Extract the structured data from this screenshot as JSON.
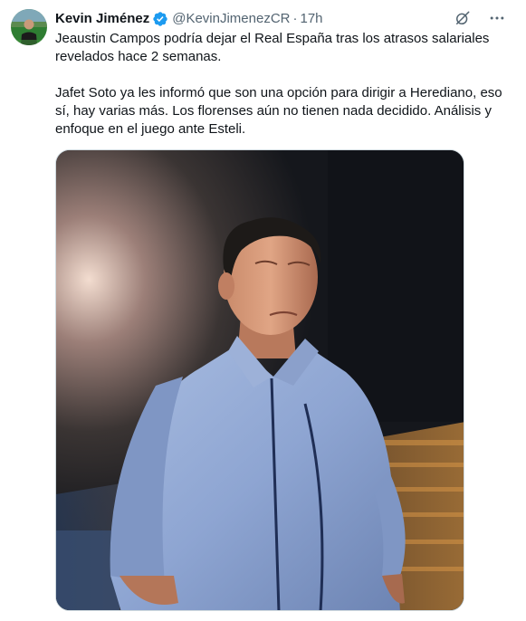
{
  "tweet": {
    "author": {
      "display_name": "Kevin Jiménez",
      "handle": "@KevinJimenezCR",
      "verified": true,
      "avatar_icon": "user-avatar"
    },
    "separator": "·",
    "timestamp": "17h",
    "text": {
      "paragraph_1": "Jeaustin Campos podría dejar el Real España tras los atrasos salariales revelados hace 2 semanas.",
      "paragraph_2": "Jafet Soto ya les informó que son una opción para dirigir a Herediano, eso sí, hay varias más. Los florenses aún no tienen nada decidido. Análisis y enfoque en el juego ante Esteli."
    },
    "actions": {
      "grok_icon": "grok-icon",
      "more_icon": "more-options-icon"
    },
    "media": {
      "type": "photo",
      "icon": "photo-man-in-stadium"
    }
  },
  "colors": {
    "text_primary": "#0f1419",
    "text_secondary": "#536471",
    "verified_blue": "#1d9bf0",
    "border": "#cfd9de"
  }
}
